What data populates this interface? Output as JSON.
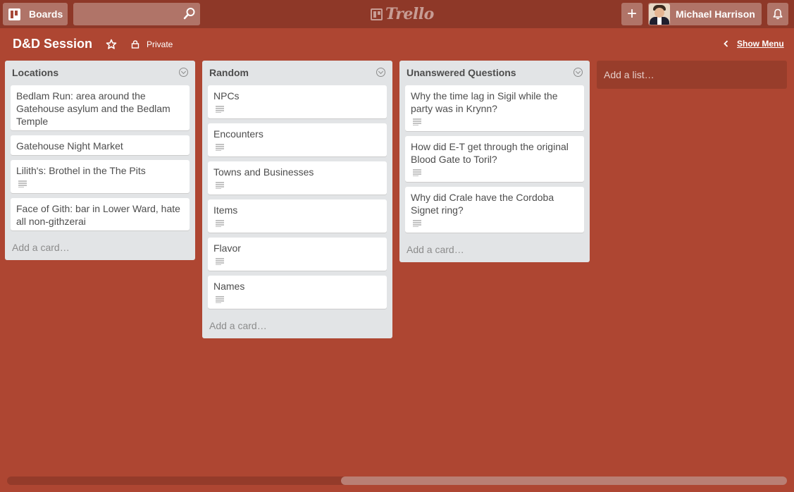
{
  "header": {
    "boards_label": "Boards",
    "search_placeholder": "",
    "logo_text": "Trello",
    "add_label": "+",
    "member_name": "Michael Harrison"
  },
  "board": {
    "title": "D&D Session",
    "privacy": "Private",
    "show_menu": "Show Menu"
  },
  "lists": [
    {
      "title": "Locations",
      "cards": [
        {
          "text": "Bedlam Run: area around the Gatehouse asylum and the Bedlam Temple",
          "has_description": false
        },
        {
          "text": "Gatehouse Night Market",
          "has_description": false
        },
        {
          "text": "Lilith's: Brothel in the The Pits",
          "has_description": true
        },
        {
          "text": "Face of Gith: bar in Lower Ward, hate all non-githzerai",
          "has_description": false
        }
      ],
      "add_card": "Add a card…"
    },
    {
      "title": "Random",
      "cards": [
        {
          "text": "NPCs",
          "has_description": true
        },
        {
          "text": "Encounters",
          "has_description": true
        },
        {
          "text": "Towns and Businesses",
          "has_description": true
        },
        {
          "text": "Items",
          "has_description": true
        },
        {
          "text": "Flavor",
          "has_description": true
        },
        {
          "text": "Names",
          "has_description": true
        }
      ],
      "add_card": "Add a card…"
    },
    {
      "title": "Unanswered Questions",
      "cards": [
        {
          "text": "Why the time lag in Sigil while the party was in Krynn?",
          "has_description": true
        },
        {
          "text": "How did E-T get through the original Blood Gate to Toril?",
          "has_description": true
        },
        {
          "text": "Why did Crale have the Cordoba Signet ring?",
          "has_description": true
        }
      ],
      "add_card": "Add a card…"
    }
  ],
  "add_list": "Add a list…",
  "colors": {
    "board_background": "#ae4632",
    "header_background": "#8e3828",
    "list_background": "#e2e4e6",
    "card_background": "#ffffff"
  }
}
